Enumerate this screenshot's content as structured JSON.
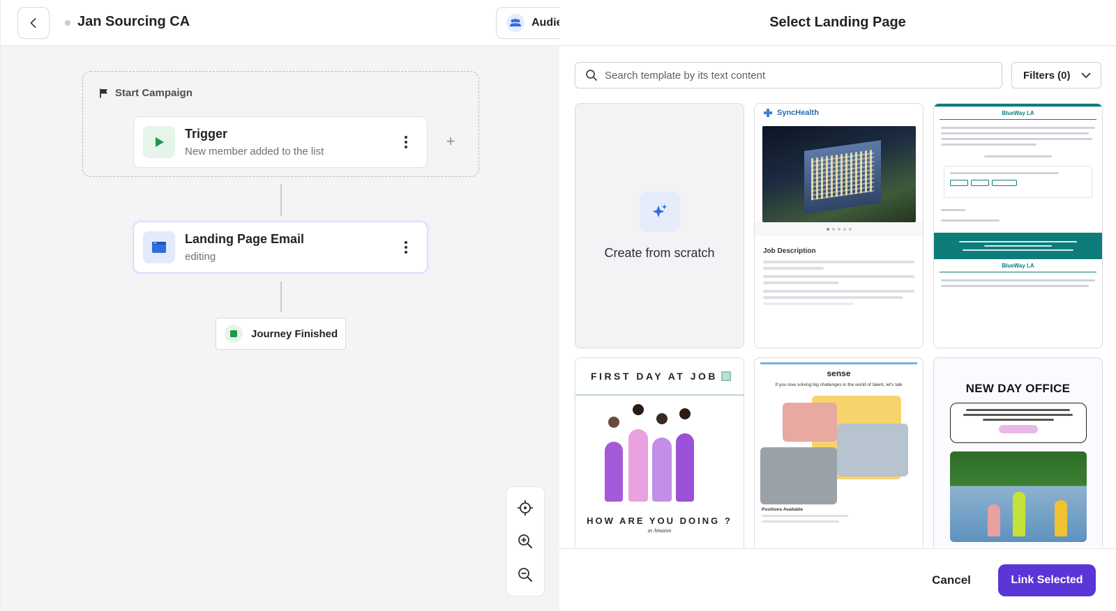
{
  "journey": {
    "campaign_name": "Jan Sourcing CA",
    "audience_label": "Audie",
    "start_label": "Start Campaign",
    "trigger": {
      "title": "Trigger",
      "subtitle": "New member added to the list"
    },
    "email_step": {
      "title": "Landing Page Email",
      "subtitle": "editing"
    },
    "end_label": "Journey Finished"
  },
  "modal": {
    "title": "Select Landing Page",
    "search_placeholder": "Search template by its text content",
    "filters_label": "Filters (0)",
    "create_label": "Create from scratch",
    "cancel_label": "Cancel",
    "link_label": "Link Selected",
    "templates": {
      "sync": {
        "brand": "SyncHealth",
        "section": "Job Description"
      },
      "bluewave": {
        "brand": "BlueWay LA"
      },
      "first_day": {
        "title": "FIRST DAY AT JOB",
        "bottom": "HOW ARE YOU DOING ?",
        "sub": "at Amazon"
      },
      "sense": {
        "brand": "sense",
        "tagline": "If you love solving big challenges in the world of talent, let's talk",
        "section": "Positions Available"
      },
      "new_day": {
        "title": "NEW DAY OFFICE"
      }
    }
  },
  "colors": {
    "accent": "#5b35d5",
    "teal": "#0e7c7b",
    "green": "#1b9a4a",
    "blue": "#2f6de0"
  }
}
